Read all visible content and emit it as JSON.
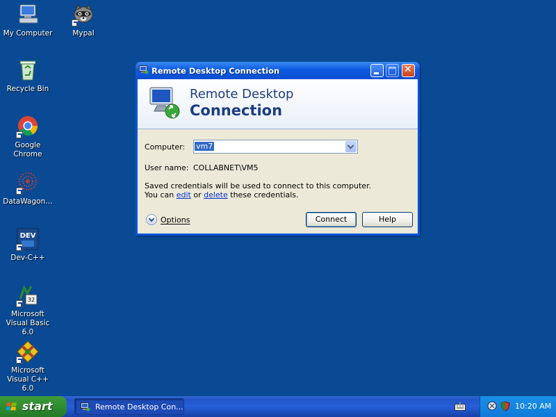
{
  "desktop": {
    "icons": [
      {
        "label": "My Computer"
      },
      {
        "label": "Mypal"
      },
      {
        "label": "Recycle Bin"
      },
      {
        "label": "Google Chrome"
      },
      {
        "label": "DataWagon…"
      },
      {
        "label": "Dev-C++"
      },
      {
        "label": "Microsoft Visual Basic 6.0"
      },
      {
        "label": "Microsoft Visual C++ 6.0"
      }
    ]
  },
  "window": {
    "title": "Remote Desktop Connection",
    "banner": {
      "line1": "Remote Desktop",
      "line2": "Connection"
    },
    "computer": {
      "label": "Computer:",
      "value": "vm7"
    },
    "username": {
      "label": "User name:",
      "value": "COLLABNET\\VM5"
    },
    "info": {
      "line1": "Saved credentials will be used to connect to this computer.",
      "prefix": "You can",
      "edit_link": "edit",
      "or": "or",
      "delete_link": "delete",
      "suffix": "these credentials."
    },
    "options_label": "Options",
    "connect_label": "Connect",
    "help_label": "Help"
  },
  "taskbar": {
    "start_label": "start",
    "task_label": "Remote Desktop Con...",
    "clock": "10:20 AM"
  },
  "colors": {
    "desktop": "#0a4a94",
    "titlebar": "#0b55dd",
    "dialog": "#ece9d8",
    "start": "#2f8c2f"
  }
}
